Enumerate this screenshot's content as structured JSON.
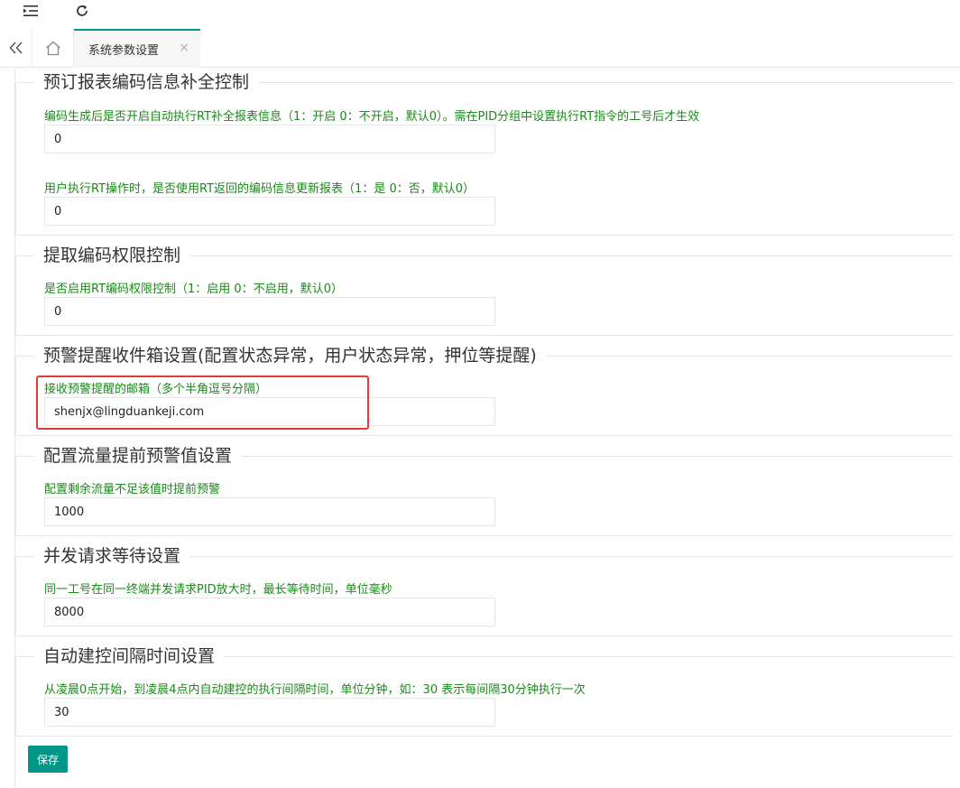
{
  "header": {
    "menu_icon": "menu-fold-icon",
    "refresh_icon": "refresh-icon"
  },
  "tabs": {
    "collapse_icon": "double-chevron-left-icon",
    "home_icon": "home-icon",
    "active_tab_label": "系统参数设置",
    "close_glyph": "×"
  },
  "groups": [
    {
      "title": "预订报表编码信息补全控制",
      "fields": [
        {
          "label": "编码生成后是否开启自动执行RT补全报表信息（1：开启 0：不开启，默认0）。需在PID分组中设置执行RT指令的工号后才生效",
          "value": "0"
        },
        {
          "label": "用户执行RT操作时，是否使用RT返回的编码信息更新报表（1：是 0：否，默认0）",
          "value": "0"
        }
      ]
    },
    {
      "title": "提取编码权限控制",
      "fields": [
        {
          "label": "是否启用RT编码权限控制（1：启用 0：不启用，默认0）",
          "value": "0"
        }
      ]
    },
    {
      "title": "预警提醒收件箱设置(配置状态异常，用户状态异常，押位等提醒)",
      "fields": [
        {
          "label": "接收预警提醒的邮箱（多个半角逗号分隔）",
          "value": "shenjx@lingduankeji.com"
        }
      ]
    },
    {
      "title": "配置流量提前预警值设置",
      "fields": [
        {
          "label": "配置剩余流量不足该值时提前预警",
          "value": "1000"
        }
      ]
    },
    {
      "title": "并发请求等待设置",
      "fields": [
        {
          "label": "同一工号在同一终端并发请求PID放大时，最长等待时间，单位毫秒",
          "value": "8000"
        }
      ]
    },
    {
      "title": "自动建控间隔时间设置",
      "fields": [
        {
          "label": "从凌晨0点开始，到凌晨4点内自动建控的执行间隔时间，单位分钟，如：30 表示每间隔30分钟执行一次",
          "value": "30"
        }
      ]
    }
  ],
  "save_button": {
    "label": "保存"
  },
  "colors": {
    "accent": "#009688",
    "label_green": "#1a8a1a",
    "highlight_red": "#e53935"
  }
}
